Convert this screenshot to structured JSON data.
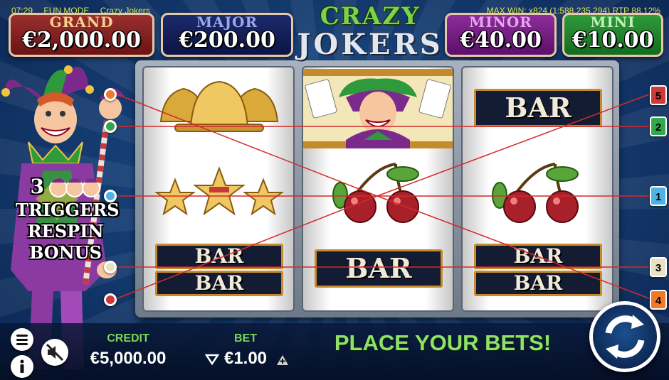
{
  "status": {
    "time": "07:29",
    "mode": "FUN MODE",
    "game": "Crazy Jokers",
    "info": "MAX WIN: x824 (1:588,235,294) RTP 88.12%"
  },
  "jackpots": {
    "grand": {
      "name": "GRAND",
      "value": "€2,000.00"
    },
    "major": {
      "name": "MAJOR",
      "value": "€200.00"
    },
    "minor": {
      "name": "MINOR",
      "value": "€40.00"
    },
    "mini": {
      "name": "MINI",
      "value": "€10.00"
    }
  },
  "logo": {
    "line1": "CRAZY",
    "line2": "JOKERS"
  },
  "reels": {
    "reel1": [
      "bells",
      "stars",
      "double-bar"
    ],
    "reel2": [
      "jester",
      "cherries",
      "bar"
    ],
    "reel3": [
      "bar",
      "cherries",
      "double-bar"
    ],
    "bar_text": "BAR"
  },
  "paylines": {
    "right_labels": [
      "5",
      "2",
      "1",
      "3",
      "4"
    ],
    "colors": {
      "1": "#4fb3e8",
      "2": "#33a84a",
      "3": "#e8e2c4",
      "4": "#f07a2a",
      "5": "#cc3a3a"
    }
  },
  "promo": {
    "count": "3",
    "line1": "TRIGGERS",
    "line2": "RESPIN",
    "line3": "BONUS"
  },
  "footer": {
    "credit_label": "CREDIT",
    "credit_value": "€5,000.00",
    "bet_label": "BET",
    "bet_value": "€1.00",
    "message": "PLACE YOUR BETS!"
  },
  "icons": [
    "menu-icon",
    "info-icon",
    "sound-muted-icon",
    "bet-decrease-icon",
    "bet-increase-icon",
    "spin-icon"
  ]
}
